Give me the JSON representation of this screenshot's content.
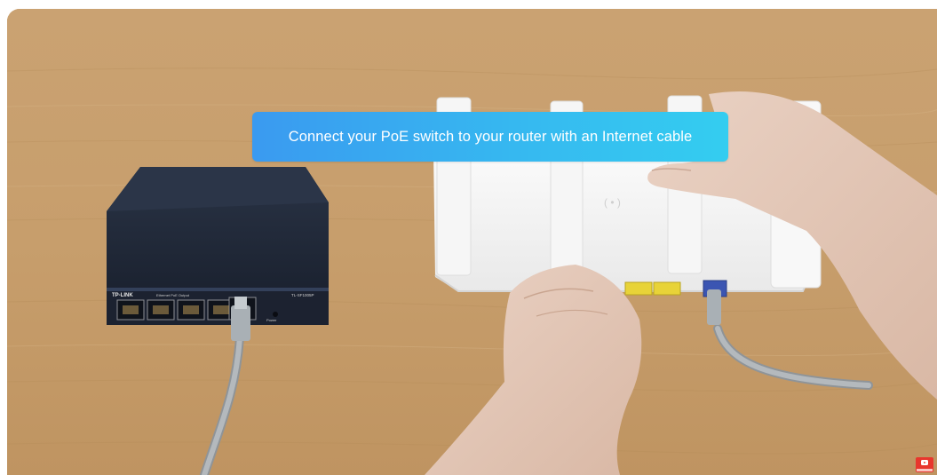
{
  "video": {
    "caption": "Connect your PoE switch to your router with an Internet cable",
    "switch_brand": "TP-LINK",
    "switch_model": "TL-SF1005P",
    "switch_panel_label": "Ethernet PoE Output",
    "switch_power_label": "Power",
    "caption_color_start": "#3a9af0",
    "caption_color_end": "#34cdf0",
    "subscribe_badge_icon": "youtube-subscribe-icon",
    "subscribe_badge_color": "#e8362d"
  }
}
